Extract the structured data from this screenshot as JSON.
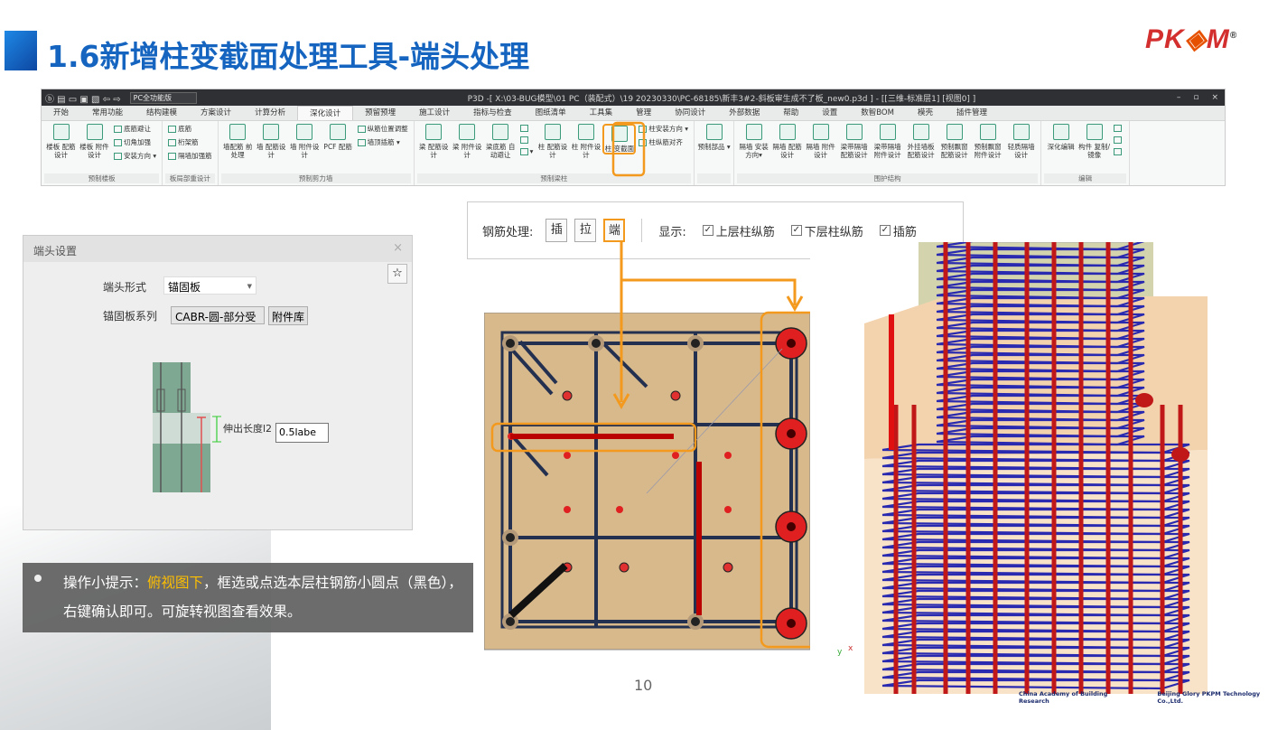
{
  "slide": {
    "title": "1.6新增柱变截面处理工具-端头处理",
    "page_number": "10",
    "logo": "PKPM",
    "colors": {
      "title": "#1565c0",
      "accent": "#f39a1e",
      "highlight_text": "#ffc000"
    }
  },
  "app": {
    "mode": "PC全功能版",
    "title": "P3D -[ X:\\03-BUG模型\\01 PC（装配式）\\19 20230330\\PC-68185\\新丰3#2-斜板审生成不了板_new0.p3d ] - [[三维-标准层1] [视图0] ]",
    "window_controls": [
      "–",
      "▫",
      "×"
    ],
    "tabs": [
      "开始",
      "常用功能",
      "结构建模",
      "方案设计",
      "计算分析",
      "深化设计",
      "预留预埋",
      "施工设计",
      "指标与检查",
      "图纸清单",
      "工具集",
      "管理",
      "协同设计",
      "外部数据",
      "帮助",
      "设置",
      "数智BOM",
      "模壳",
      "插件管理"
    ],
    "active_tab": "深化设计",
    "ribbon": [
      {
        "label": "预制楼板",
        "items": [
          {
            "type": "big",
            "label": "楼板 配筋设计"
          },
          {
            "type": "big",
            "label": "楼板 附件设计"
          },
          {
            "type": "small",
            "labels": [
              "底筋避让",
              "切角加强",
              "安装方向 ▾"
            ]
          }
        ]
      },
      {
        "label": "板局部重设计",
        "items": [
          {
            "type": "small",
            "labels": [
              "底筋",
              "桁架筋",
              "隔墙加强筋"
            ]
          }
        ]
      },
      {
        "label": "预制剪力墙",
        "items": [
          {
            "type": "big",
            "label": "墙配筋 前处理"
          },
          {
            "type": "big",
            "label": "墙 配筋设计"
          },
          {
            "type": "big",
            "label": "墙 附件设计"
          },
          {
            "type": "big",
            "label": "PCF 配筋"
          },
          {
            "type": "small",
            "labels": [
              "纵筋位置调整",
              "墙顶插筋 ▾"
            ]
          }
        ]
      },
      {
        "label": "预制梁柱",
        "items": [
          {
            "type": "big",
            "label": "梁 配筋设计"
          },
          {
            "type": "big",
            "label": "梁 附件设计"
          },
          {
            "type": "big",
            "label": "梁底筋 自动避让"
          },
          {
            "type": "small",
            "labels": [
              "",
              "",
              "▾"
            ]
          },
          {
            "type": "big",
            "label": "柱 配筋设计"
          },
          {
            "type": "big",
            "label": "柱 附件设计"
          },
          {
            "type": "big",
            "label": "柱 变截面",
            "highlight": true
          },
          {
            "type": "small",
            "labels": [
              "柱安装方向 ▾",
              "柱纵筋对齐"
            ]
          }
        ]
      },
      {
        "label": "",
        "items": [
          {
            "type": "big",
            "label": "预制部品 ▾"
          }
        ]
      },
      {
        "label": "围护结构",
        "items": [
          {
            "type": "big",
            "label": "隔墙 安装方向▾"
          },
          {
            "type": "big",
            "label": "隔墙 配筋设计"
          },
          {
            "type": "big",
            "label": "隔墙 附件设计"
          },
          {
            "type": "big",
            "label": "梁带隔墙 配筋设计"
          },
          {
            "type": "big",
            "label": "梁带隔墙 附件设计"
          },
          {
            "type": "big",
            "label": "外挂墙板 配筋设计"
          },
          {
            "type": "big",
            "label": "预制飘窗 配筋设计"
          },
          {
            "type": "big",
            "label": "预制飘窗 附件设计"
          },
          {
            "type": "big",
            "label": "轻质隔墙 设计"
          }
        ]
      },
      {
        "label": "编辑",
        "items": [
          {
            "type": "big",
            "label": "深化编辑"
          },
          {
            "type": "big",
            "label": "构件 复制/镜像"
          },
          {
            "type": "small",
            "labels": [
              "",
              "",
              ""
            ]
          }
        ]
      }
    ]
  },
  "rebar_toolbar": {
    "label": "钢筋处理:",
    "buttons": [
      "插",
      "拉",
      "端"
    ],
    "selected": "端",
    "display_label": "显示:",
    "checks": [
      {
        "label": "上层柱纵筋",
        "checked": true
      },
      {
        "label": "下层柱纵筋",
        "checked": true
      },
      {
        "label": "插筋",
        "checked": true
      }
    ]
  },
  "dialog": {
    "title": "端头设置",
    "close": "×",
    "end_form_label": "端头形式",
    "end_form_value": "锚固板",
    "series_label": "锚固板系列",
    "series_value": "CABR-圆-部分受",
    "library_button": "附件库",
    "extend_label": "伸出长度l2",
    "extend_value": "0.5labe"
  },
  "tip": {
    "prefix": "操作小提示：",
    "highlight": "俯视图下",
    "rest": "，框选或点选本层柱钢筋小圆点（黑色），右键确认即可。可旋转视图查看效果。"
  },
  "footer": {
    "org1": "China Academy of Building Research",
    "org2": "Beijing Glory PKPM Technology Co.,Ltd."
  }
}
